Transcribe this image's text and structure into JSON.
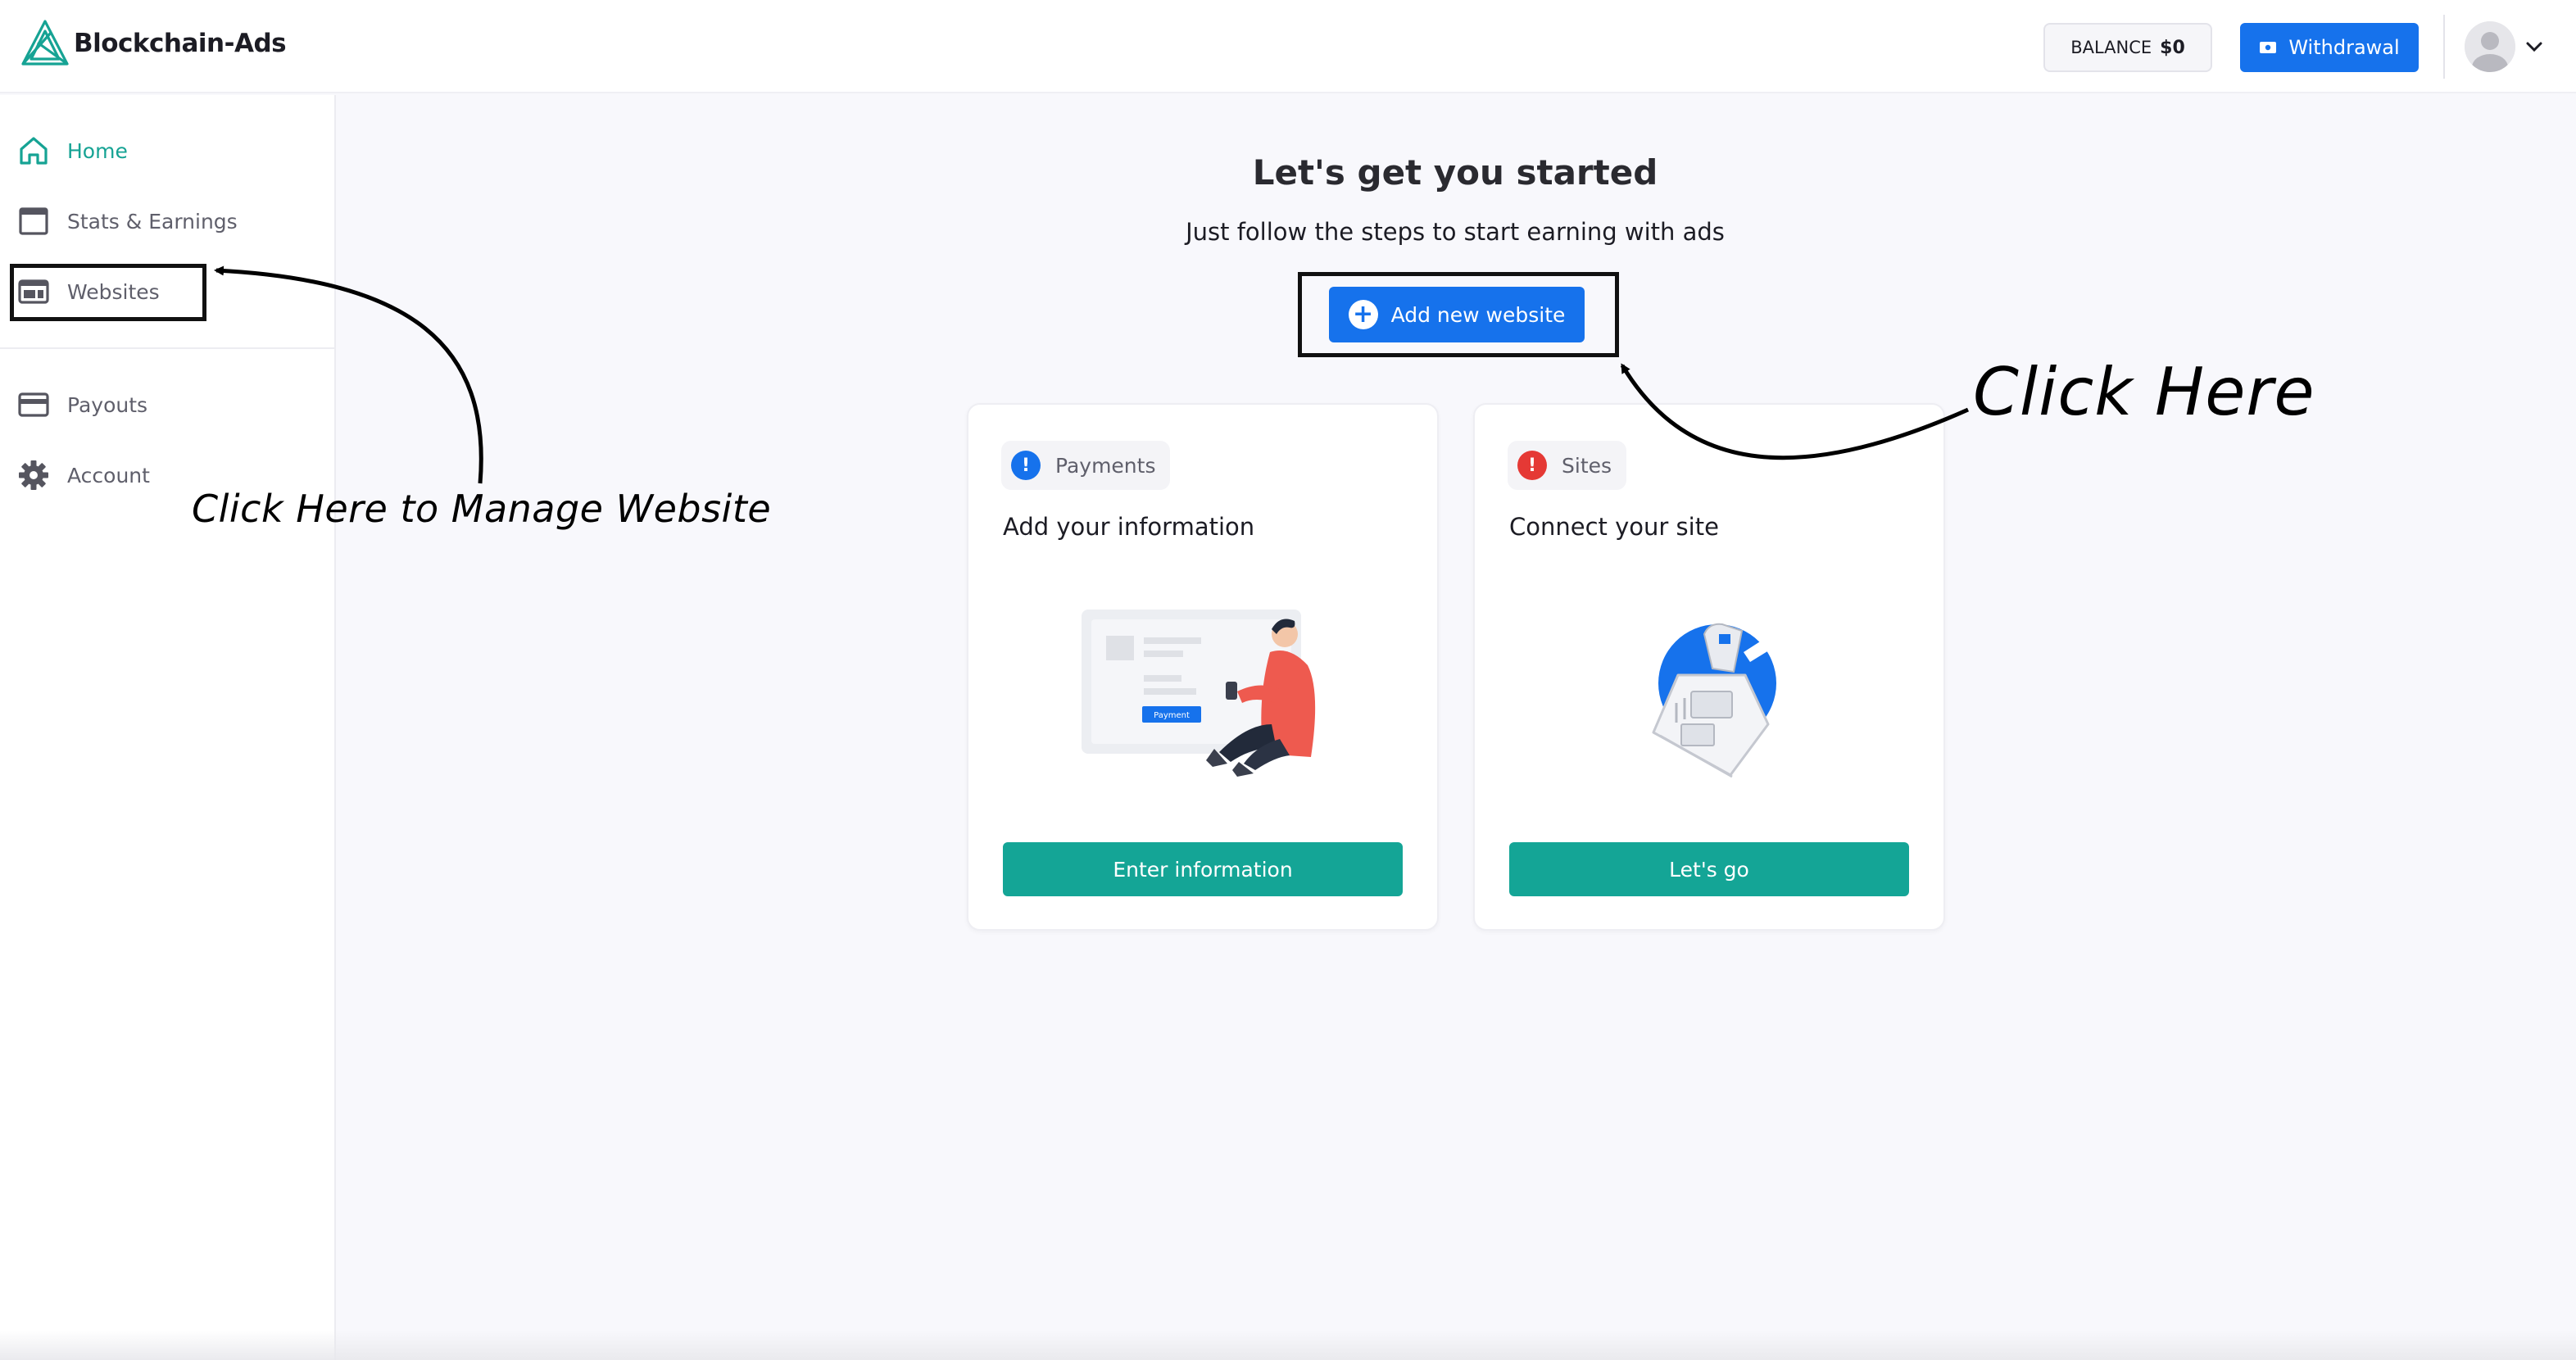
{
  "brand": {
    "name": "Blockchain-Ads",
    "color": "#16a394"
  },
  "header": {
    "balance_label": "BALANCE",
    "balance_value": "$0",
    "withdraw_label": "Withdrawal",
    "withdraw_icon": "cash-icon",
    "avatar_icon": "user-avatar-icon",
    "menu_icon": "chevron-down-icon"
  },
  "sidebar": {
    "items": [
      {
        "label": "Home",
        "icon": "home-icon",
        "active": true
      },
      {
        "label": "Stats & Earnings",
        "icon": "window-icon"
      },
      {
        "label": "Websites",
        "icon": "website-icon"
      },
      {
        "label": "Payouts",
        "icon": "credit-card-icon"
      },
      {
        "label": "Account",
        "icon": "gear-icon"
      }
    ]
  },
  "main": {
    "title": "Let's get you started",
    "subtitle": "Just follow the steps to start earning with ads",
    "add_button": "Add new website",
    "cards": [
      {
        "chip": "Payments",
        "chip_color": "#1672ec",
        "title": "Add your information",
        "illustration_label": "Payment",
        "button": "Enter information"
      },
      {
        "chip": "Sites",
        "chip_color": "#e53935",
        "title": "Connect your site",
        "button": "Let's go"
      }
    ]
  },
  "annotations": {
    "left": "Click Here to Manage Website",
    "right": "Click Here"
  },
  "colors": {
    "primary": "#1672ec",
    "teal": "#14a596",
    "alert": "#e53935"
  }
}
